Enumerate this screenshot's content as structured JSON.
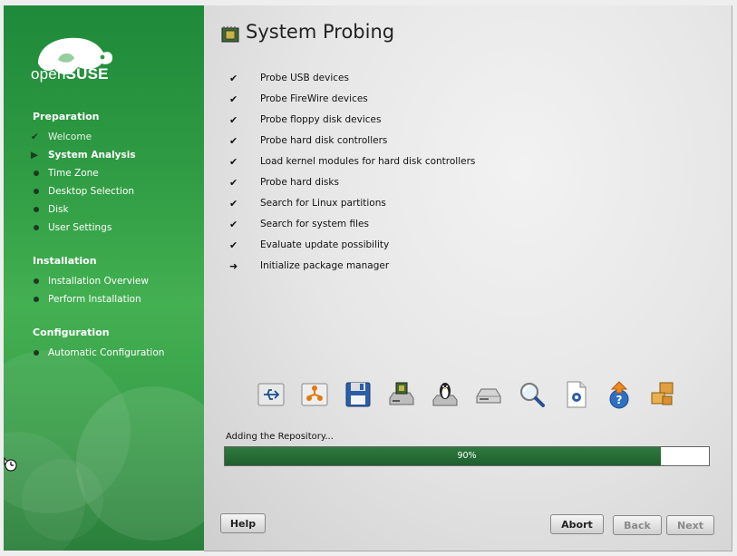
{
  "brand": {
    "open": "open",
    "suse": "SUSE"
  },
  "sidebar": {
    "sections": [
      {
        "title": "Preparation",
        "steps": [
          {
            "label": "Welcome",
            "state": "done"
          },
          {
            "label": "System Analysis",
            "state": "current"
          },
          {
            "label": "Time Zone",
            "state": "pending"
          },
          {
            "label": "Desktop Selection",
            "state": "pending"
          },
          {
            "label": "Disk",
            "state": "pending"
          },
          {
            "label": "User Settings",
            "state": "pending"
          }
        ]
      },
      {
        "title": "Installation",
        "steps": [
          {
            "label": "Installation Overview",
            "state": "pending"
          },
          {
            "label": "Perform Installation",
            "state": "pending"
          }
        ]
      },
      {
        "title": "Configuration",
        "steps": [
          {
            "label": "Automatic Configuration",
            "state": "pending"
          }
        ]
      }
    ]
  },
  "main": {
    "title": "System Probing",
    "probes": [
      {
        "label": "Probe USB devices",
        "status": "done"
      },
      {
        "label": "Probe FireWire devices",
        "status": "done"
      },
      {
        "label": "Probe floppy disk devices",
        "status": "done"
      },
      {
        "label": "Probe hard disk controllers",
        "status": "done"
      },
      {
        "label": "Load kernel modules for hard disk controllers",
        "status": "done"
      },
      {
        "label": "Probe hard disks",
        "status": "done"
      },
      {
        "label": "Search for Linux partitions",
        "status": "done"
      },
      {
        "label": "Search for system files",
        "status": "done"
      },
      {
        "label": "Evaluate update possibility",
        "status": "done"
      },
      {
        "label": "Initialize package manager",
        "status": "current"
      }
    ],
    "marks": {
      "done": "✔",
      "current": "➜"
    },
    "icons": [
      "usb-icon",
      "firewire-icon",
      "floppy-icon",
      "hard-disk-controller-icon",
      "linux-penguin-icon",
      "hard-disk-icon",
      "search-icon",
      "system-file-icon",
      "update-icon",
      "package-icon"
    ],
    "progress": {
      "label": "Adding the Repository...",
      "value": 0.9,
      "text": "90%"
    }
  },
  "buttons": {
    "help": "Help",
    "abort": "Abort",
    "back": "Back",
    "next": "Next"
  },
  "colors": {
    "sidebar_green": "#2f9b43",
    "progress_green": "#2e7a3e"
  }
}
